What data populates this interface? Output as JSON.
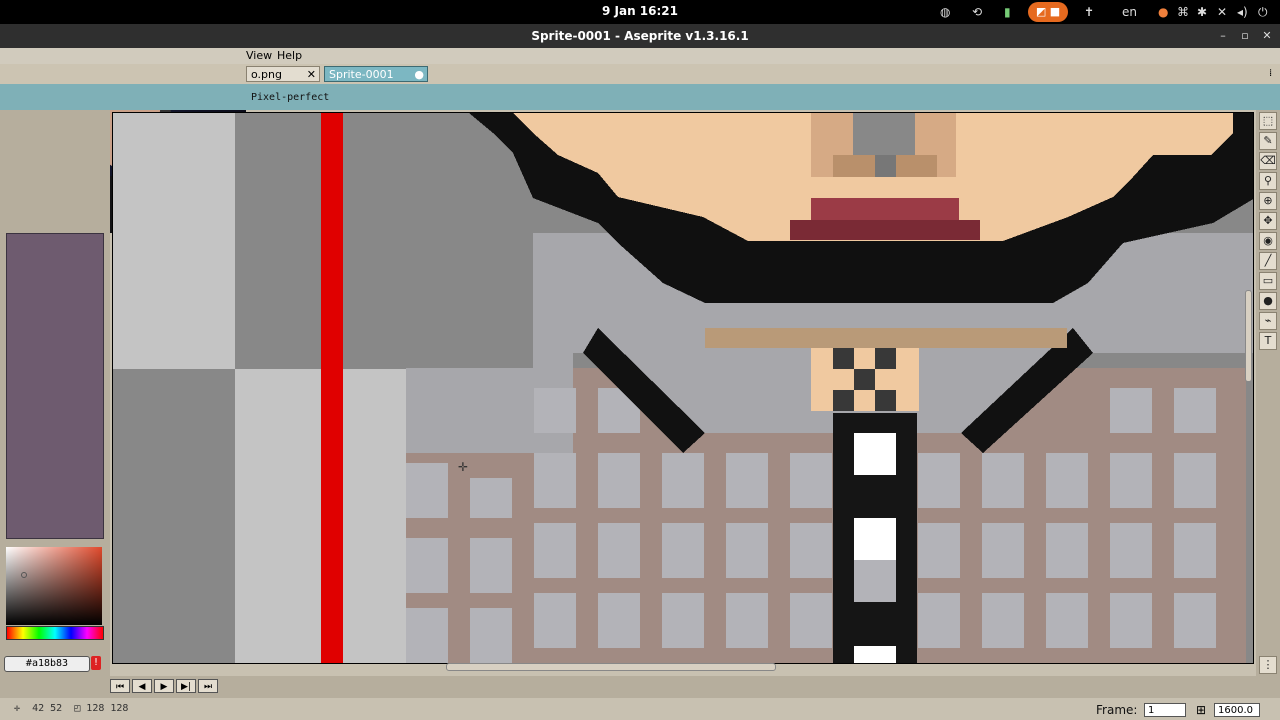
{
  "topbar": {
    "clock": "9 Jan  16:21",
    "lang": "en"
  },
  "window": {
    "title": "Sprite-0001 - Aseprite v1.3.16.1"
  },
  "menu": {
    "items": [
      "View",
      "Help"
    ]
  },
  "tabs": [
    {
      "label": "o.png",
      "close": "✕"
    },
    {
      "label": "Sprite-0001",
      "modified": "●"
    }
  ],
  "context_bar": {
    "pixel_perfect_label": "Pixel-perfect"
  },
  "colors": {
    "foreground_hex": "#a18b83",
    "background_hex": "#cccccd",
    "warn_glyph": "!"
  },
  "timeline": {
    "frame_label": "Frame:",
    "frame_value": "1",
    "zoom_value": "1600.0"
  },
  "status": {
    "coords": "42 52",
    "size": "128 128"
  }
}
